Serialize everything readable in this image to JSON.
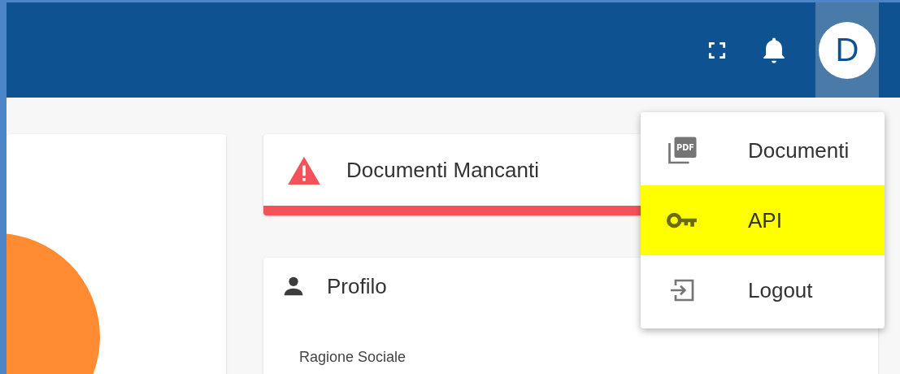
{
  "header": {
    "avatar": {
      "initial": "D",
      "selected": true
    }
  },
  "alert": {
    "title": "Documenti Mancanti"
  },
  "profile": {
    "title": "Profilo",
    "field_label": "Ragione Sociale"
  },
  "user_menu": {
    "items": [
      {
        "kind": "pdf",
        "icon_text": "PDF",
        "label": "Documenti",
        "highlighted": false
      },
      {
        "kind": "key",
        "label": "API",
        "highlighted": true
      },
      {
        "kind": "logout",
        "label": "Logout",
        "highlighted": false
      }
    ]
  }
}
